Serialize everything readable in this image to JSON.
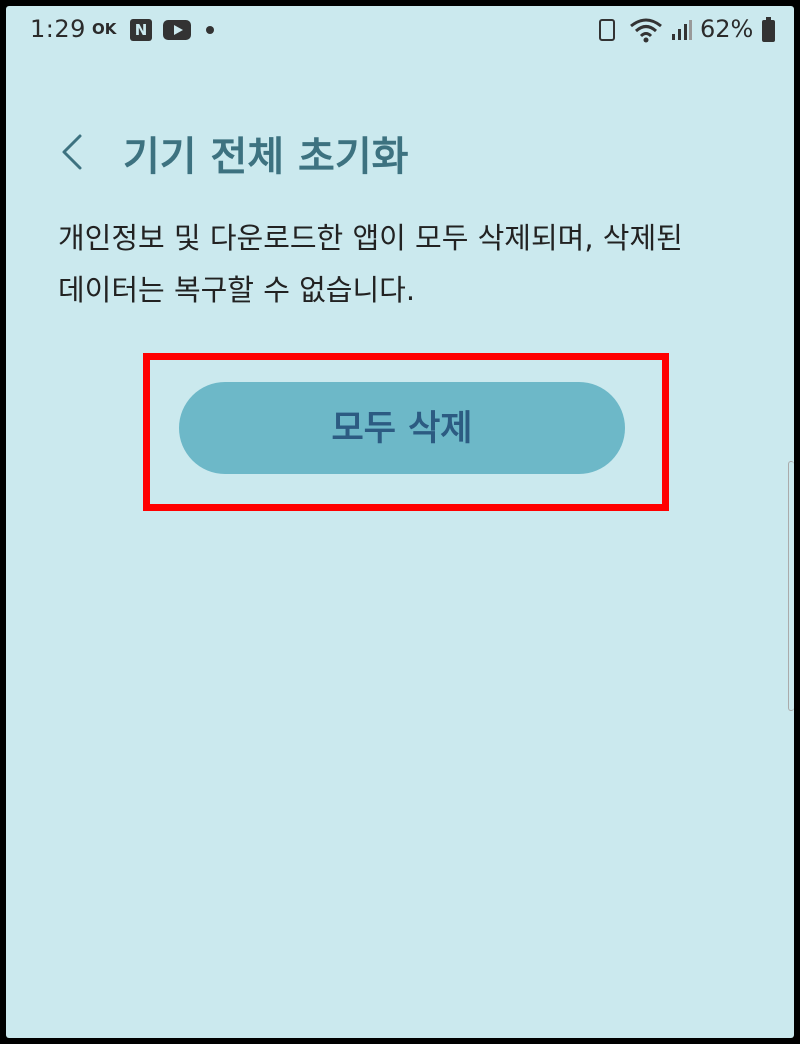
{
  "status_bar": {
    "time": "1:29",
    "ok_label": "OK",
    "n_label": "N",
    "battery_percent": "62%",
    "icons": [
      "ok-icon",
      "naver-icon",
      "youtube-icon",
      "dot-icon",
      "battery-saver-icon",
      "wifi-icon",
      "signal-icon",
      "battery-icon"
    ]
  },
  "header": {
    "back_icon": "chevron-left-icon",
    "title": "기기 전체 초기화"
  },
  "main": {
    "description_line1": "개인정보 및 다운로드한 앱이 모두 삭제되며, 삭제된",
    "description_line2": "데이터는 복구할 수 없습니다.",
    "delete_all_label": "모두 삭제"
  },
  "colors": {
    "background": "#cbe9ee",
    "title": "#3d7280",
    "button_bg": "#6db8c8",
    "button_text": "#2c5b82",
    "highlight": "#ff0000"
  }
}
